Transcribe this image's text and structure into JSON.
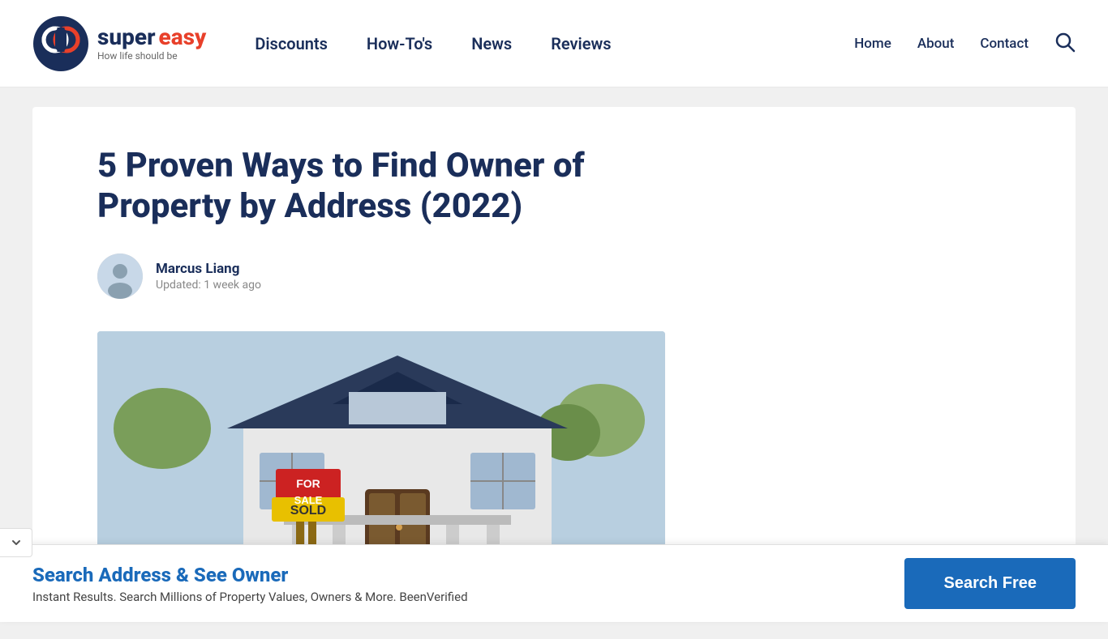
{
  "header": {
    "logo": {
      "super": "super",
      "easy": "easy",
      "tagline": "How life should be"
    },
    "nav": {
      "items": [
        {
          "label": "Discounts",
          "id": "discounts"
        },
        {
          "label": "How-To's",
          "id": "howtos"
        },
        {
          "label": "News",
          "id": "news"
        },
        {
          "label": "Reviews",
          "id": "reviews"
        }
      ]
    },
    "right_nav": {
      "items": [
        {
          "label": "Home",
          "id": "home"
        },
        {
          "label": "About",
          "id": "about"
        },
        {
          "label": "Contact",
          "id": "contact"
        }
      ]
    }
  },
  "article": {
    "title": "5 Proven Ways to Find Owner of Property by Address (2022)",
    "author_name": "Marcus Liang",
    "author_updated": "Updated: 1 week ago"
  },
  "sticky": {
    "title": "Search Address & See Owner",
    "subtitle": "Instant Results. Search Millions of Property Values, Owners & More. BeenVerified",
    "cta_label": "Search Free"
  }
}
